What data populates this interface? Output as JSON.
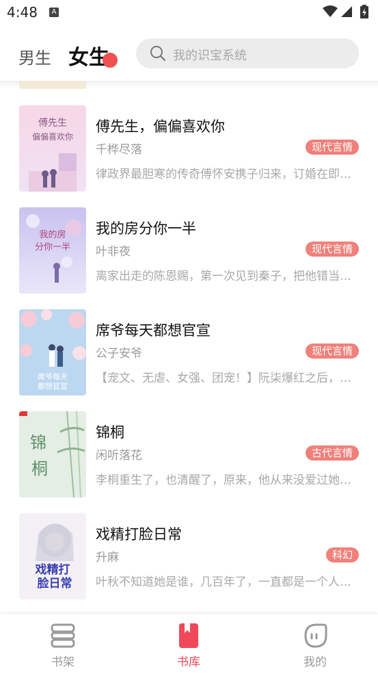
{
  "status_bar": {
    "time": "4:48"
  },
  "header": {
    "tab_male": "男生",
    "tab_female": "女生",
    "search_placeholder": "我的识宝系统"
  },
  "colors": {
    "accent": "#f0485a",
    "tag_bg": "#f0807a",
    "search_bg": "#ececec"
  },
  "books": [
    {
      "title": "傅先生，偏偏喜欢你",
      "author": "千桦尽落",
      "tag": "现代言情",
      "desc": "律政界最胆寒的传奇傅怀安携子归来，订婚在即却…",
      "cover_title": "傅先生 偏偏喜欢你"
    },
    {
      "title": "我的房分你一半",
      "author": "叶非夜",
      "tag": "现代言情",
      "desc": "离家出走的陈恩赐，第一次见到秦子，把他错当成…",
      "cover_title": "我的房 分你一半"
    },
    {
      "title": "席爷每天都想官宣",
      "author": "公子安爷",
      "tag": "现代言情",
      "desc": "【宠文、无虐、女强、团宠！】阮柒爆红之后，…",
      "cover_title": "席爷每天 都想官宣"
    },
    {
      "title": "锦桐",
      "author": "闲听落花",
      "tag": "古代言情",
      "desc": "李桐重生了，也清醒了，原来，他从来没爱过她，…",
      "cover_title": "锦 桐"
    },
    {
      "title": "戏精打脸日常",
      "author": "升麻",
      "tag": "科幻",
      "desc": "叶秋不知道她是谁，几百年了，一直都是一个人…",
      "cover_title": "戏精打 脸日常"
    }
  ],
  "bottom_nav": [
    {
      "label": "书架",
      "icon": "bookshelf-icon",
      "active": false
    },
    {
      "label": "书库",
      "icon": "bookmark-icon",
      "active": true
    },
    {
      "label": "我的",
      "icon": "face-icon",
      "active": false
    }
  ]
}
